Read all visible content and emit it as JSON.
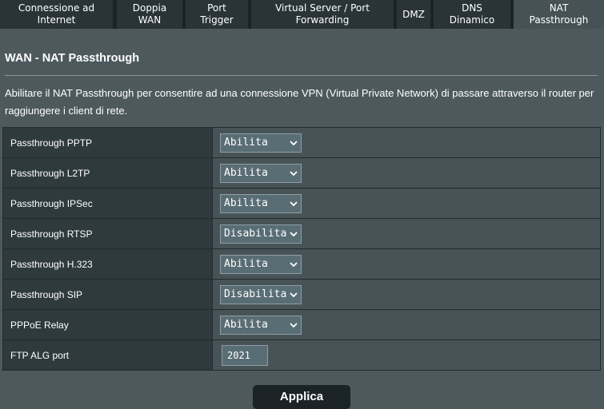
{
  "tabs": [
    {
      "label_line1": "Connessione ad",
      "label_line2": "Internet",
      "active": false
    },
    {
      "label_line1": "Doppia",
      "label_line2": "WAN",
      "active": false
    },
    {
      "label_line1": "Port",
      "label_line2": "Trigger",
      "active": false
    },
    {
      "label_line1": "Virtual Server / Port",
      "label_line2": "Forwarding",
      "active": false
    },
    {
      "label_line1": "DMZ",
      "label_line2": "",
      "active": false
    },
    {
      "label_line1": "DNS",
      "label_line2": "Dinamico",
      "active": false
    },
    {
      "label_line1": "NAT",
      "label_line2": "Passthrough",
      "active": true
    }
  ],
  "page": {
    "title": "WAN - NAT Passthrough",
    "description": "Abilitare il NAT Passthrough per consentire ad una connessione VPN (Virtual Private Network) di passare attraverso il router per raggiungere i client di rete."
  },
  "settings": [
    {
      "label": "Passthrough PPTP",
      "value": "Abilita"
    },
    {
      "label": "Passthrough L2TP",
      "value": "Abilita"
    },
    {
      "label": "Passthrough IPSec",
      "value": "Abilita"
    },
    {
      "label": "Passthrough RTSP",
      "value": "Disabilita"
    },
    {
      "label": "Passthrough H.323",
      "value": "Abilita"
    },
    {
      "label": "Passthrough SIP",
      "value": "Disabilita"
    },
    {
      "label": "PPPoE Relay",
      "value": "Abilita"
    },
    {
      "label": "FTP ALG port",
      "value": "2021"
    }
  ],
  "apply_button_label": "Applica",
  "colors": {
    "background": "#4d595d",
    "tab_bar": "#1c2325",
    "tab": "#2a3438",
    "tab_active": "#465256",
    "label_cell": "#2f3a3e",
    "value_cell": "#475357",
    "control": "#596d74"
  }
}
